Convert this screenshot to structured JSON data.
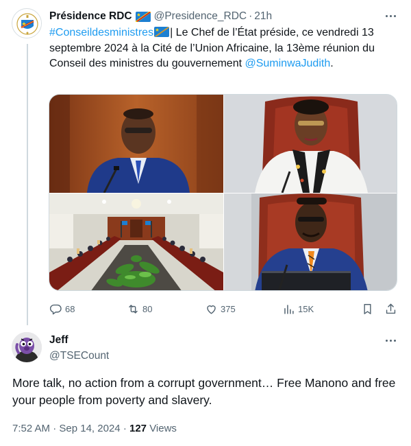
{
  "parent_tweet": {
    "author_name": "Présidence RDC",
    "author_handle": "@Presidence_RDC",
    "separator": "·",
    "time_ago": "21h",
    "hashtag": "#Conseildesministres",
    "text_after_hashtag": "| Le Chef de l’État préside, ce vendredi 13 septembre 2024 à la Cité de l’Union Africaine, la 13ème réunion du Conseil des ministres du gouvernement ",
    "mention": "@SuminwaJudith",
    "text_end": ".",
    "flag_icon": "drc-flag-icon",
    "flag_colors": {
      "blue": "#1d7fd1",
      "yellow": "#f7d618",
      "red": "#ce1021"
    },
    "media": [
      {
        "name": "president-photo"
      },
      {
        "name": "prime-minister-photo"
      },
      {
        "name": "council-room-photo"
      },
      {
        "name": "minister-photo"
      }
    ],
    "actions": {
      "replies": "68",
      "reposts": "80",
      "likes": "375",
      "views": "15K"
    }
  },
  "reply_tweet": {
    "author_name": "Jeff",
    "author_handle": "@TSECount",
    "text": "More talk, no action from a corrupt government… Free Manono and free your people from poverty and slavery.",
    "time": "7:52 AM",
    "separator": "·",
    "date": "Sep 14, 2024",
    "separator_views": "·",
    "views_count": "127",
    "views_label": "Views"
  },
  "colors": {
    "accent": "#1d9bf0",
    "text_primary": "#0f1419",
    "text_secondary": "#536471",
    "thread_line": "#cfd9de"
  }
}
